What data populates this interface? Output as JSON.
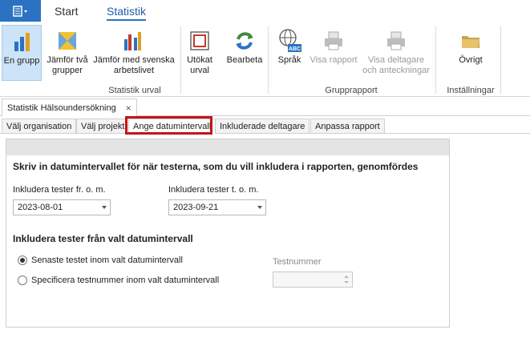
{
  "ribbon_tabs": [
    {
      "label": "Start"
    },
    {
      "label": "Statistik"
    }
  ],
  "ribbon": {
    "buttons": [
      {
        "label": "En grupp"
      },
      {
        "label": "Jämför två grupper"
      },
      {
        "label": "Jämför med svenska arbetslivet"
      },
      {
        "label": "Utökat urval"
      },
      {
        "label": "Bearbeta"
      },
      {
        "label": "Språk"
      },
      {
        "label": "Visa rapport"
      },
      {
        "label": "Visa deltagare och anteckningar"
      },
      {
        "label": "Övrigt"
      }
    ],
    "groups": [
      {
        "label": "Statistik urval"
      },
      {
        "label": "Grupprapport"
      },
      {
        "label": "Inställningar"
      }
    ],
    "lang_badge": "ABC"
  },
  "document_tab": {
    "label": "Statistik Hälsoundersökning",
    "close": "×"
  },
  "step_tabs": [
    {
      "label": "Välj organisation"
    },
    {
      "label": "Välj projekt"
    },
    {
      "label": "Ange datumintervall"
    },
    {
      "label": "Inkluderade deltagare"
    },
    {
      "label": "Anpassa rapport"
    }
  ],
  "content": {
    "heading": "Skriv in datumintervallet för när testerna, som du vill inkludera i rapporten, genomfördes",
    "from_label": "Inkludera tester fr. o. m.",
    "from_value": "2023-08-01",
    "to_label": "Inkludera tester t. o. m.",
    "to_value": "2023-09-21",
    "subheading": "Inkludera tester från valt datumintervall",
    "radio_latest": "Senaste testet inom valt datumintervall",
    "radio_specify": "Specificera testnummer inom valt datumintervall",
    "testnumber_label": "Testnummer"
  },
  "colors": {
    "accent": "#2b73c2",
    "highlight": "#c4141a"
  }
}
